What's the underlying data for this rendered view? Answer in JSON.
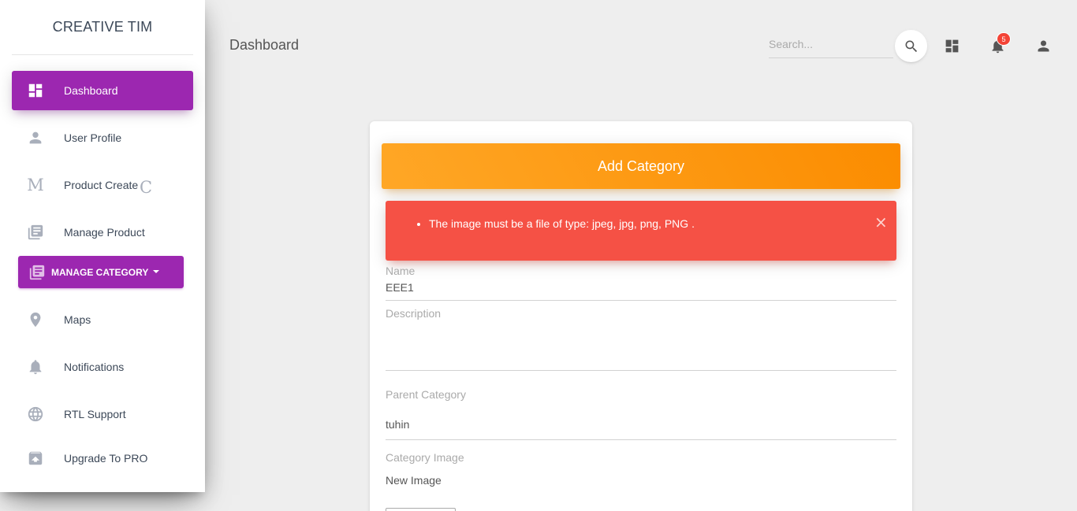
{
  "sidebar": {
    "brand": "CREATIVE TIM",
    "items": [
      {
        "label": "Dashboard",
        "icon": "dashboard-icon",
        "active": true
      },
      {
        "label": "User Profile",
        "icon": "person-icon"
      },
      {
        "label": "Product Create",
        "icon": "letter-m-icon",
        "icon_glyph": "M",
        "trailing_glyph": "C"
      },
      {
        "label": "Manage Product",
        "icon": "library-books-icon"
      }
    ],
    "dropdown": {
      "label": "MANAGE CATEGORY",
      "icon": "library-books-icon"
    },
    "items_after": [
      {
        "label": "Maps",
        "icon": "location-pin-icon"
      },
      {
        "label": "Notifications",
        "icon": "bell-icon"
      },
      {
        "label": "RTL Support",
        "icon": "globe-icon"
      },
      {
        "label": "Upgrade To PRO",
        "icon": "unarchive-icon"
      }
    ]
  },
  "navbar": {
    "title": "Dashboard",
    "search_placeholder": "Search...",
    "notification_count": "5"
  },
  "card": {
    "header": "Add Category",
    "alert_message": "The image must be a file of type: jpeg, jpg, png, PNG .",
    "alert_close": "×",
    "fields": {
      "name_label": "Name",
      "name_value": "EEE1",
      "description_label": "Description",
      "description_value": "",
      "parent_label": "Parent Category",
      "parent_value": "tuhin",
      "image_label": "Category Image",
      "image_value": "New Image"
    }
  },
  "colors": {
    "primary": "#9c27b0",
    "header_orange": "#fb8c00",
    "alert_red": "#f55145",
    "badge_red": "#f44336",
    "background": "#eeeeee"
  }
}
